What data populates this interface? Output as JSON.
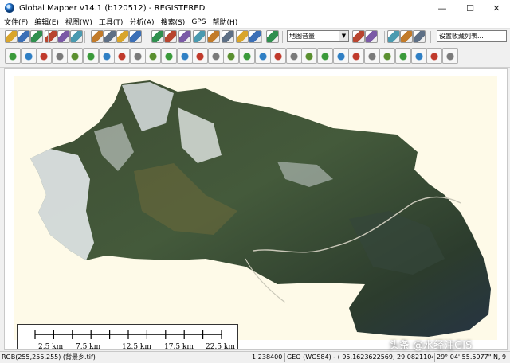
{
  "window": {
    "title": "Global Mapper v14.1 (b120512) - REGISTERED",
    "controls": {
      "minimize": "—",
      "maximize": "☐",
      "close": "✕"
    }
  },
  "menu": [
    {
      "label": "文件(F)"
    },
    {
      "label": "编辑(E)"
    },
    {
      "label": "视图(W)"
    },
    {
      "label": "工具(T)"
    },
    {
      "label": "分析(A)"
    },
    {
      "label": "搜索(S)"
    },
    {
      "label": "GPS"
    },
    {
      "label": "帮助(H)"
    }
  ],
  "toolbar": {
    "layer_select": "地图音量",
    "search_select": "设置收藏列表..."
  },
  "toolbar1_icons": [
    "folder-open-icon",
    "save-icon",
    "globe-icon",
    "catalog-icon",
    "layers-icon",
    "config-icon",
    "zoom-in-icon",
    "zoom-out-icon",
    "full-view-icon",
    "home-icon",
    "pan-icon",
    "select-icon",
    "measure-icon",
    "3d-view-icon",
    "path-profile-icon",
    "view-shed-icon",
    "threshold-icon",
    "gps-icon",
    "digitizer-icon",
    "coin-icon",
    "3d-icon",
    "lidar-icon",
    "pdf-icon",
    "options-icon"
  ],
  "toolbar2_icons": [
    "create-line-icon",
    "edit-line-icon",
    "edit-area-icon",
    "move-vertex-icon",
    "reshape-icon",
    "connect-icon",
    "rotate-icon",
    "grid-icon",
    "add-point-icon",
    "delete-icon",
    "crop-icon",
    "split-icon",
    "merge-icon",
    "buffer-icon",
    "measure-area-icon",
    "smooth-icon",
    "extrude-icon",
    "combine-icon",
    "snap-icon",
    "offset-icon",
    "copy-icon",
    "cut-icon",
    "paste-icon",
    "find-icon",
    "fill-icon",
    "bucket-icon",
    "route-icon",
    "undo-icon",
    "redo-icon"
  ],
  "scalebar": {
    "ticks": [
      "2.5 km",
      "7.5 km",
      "12.5 km",
      "17.5 km",
      "22.5 km"
    ]
  },
  "status": {
    "pixel": "RGB(255,255,255) (背景乡.tif)",
    "scale": "1:238400",
    "projection": "GEO (WGS84) - ( 95.1623622569, 29.0821104736 )",
    "coords": "29° 04' 55.5977\" N, 9"
  },
  "watermark": "头条 @水经注GIS",
  "colors": {
    "canvas_bg": "#ffffff",
    "map_frame": "#fefae8",
    "terrain_dark": "#2f3f2a",
    "snow": "#e8ecef"
  }
}
